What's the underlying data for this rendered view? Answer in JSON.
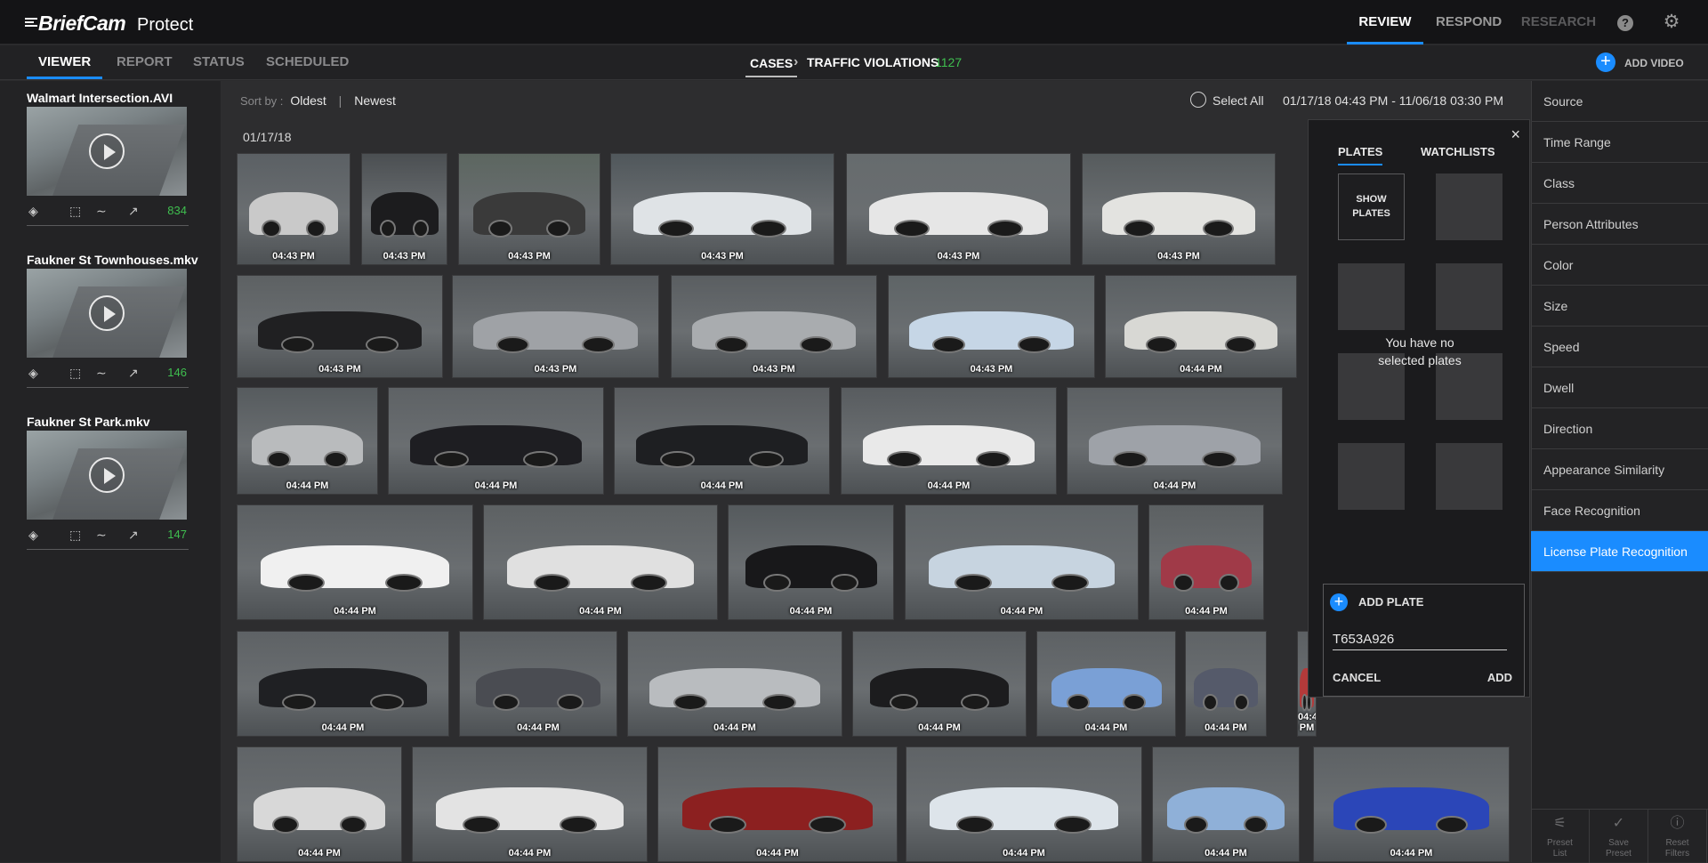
{
  "app": {
    "brand": "BriefCam",
    "product": "Protect"
  },
  "topnav": {
    "review": "REVIEW",
    "respond": "RESPOND",
    "research": "RESEARCH",
    "help": "?",
    "settings": "⚙"
  },
  "subnav": {
    "viewer": "VIEWER",
    "report": "REPORT",
    "status": "STATUS",
    "scheduled": "SCHEDULED"
  },
  "breadcrumb": {
    "cases": "CASES",
    "sep": "›",
    "current": "TRAFFIC VIOLATIONS",
    "count": "1127"
  },
  "add_video": {
    "label": "ADD VIDEO",
    "icon": "+"
  },
  "videos": [
    {
      "title": "Walmart Intersection.AVI",
      "count": "834"
    },
    {
      "title": "Faukner St Townhouses.mkv",
      "count": "146"
    },
    {
      "title": "Faukner St Park.mkv",
      "count": "147"
    }
  ],
  "sort": {
    "label": "Sort by :",
    "oldest": "Oldest",
    "sep": "|",
    "newest": "Newest"
  },
  "select_all": "Select All",
  "date_range": "01/17/18 04:43 PM - 11/06/18 03:30 PM",
  "date_group": "01/17/18",
  "tiles": [
    {
      "time": "04:43 PM",
      "color": "#c9c9c9",
      "bg": "#5b6064"
    },
    {
      "time": "04:43 PM",
      "color": "#1c1c1e",
      "bg": "#4b4f52"
    },
    {
      "time": "04:43 PM",
      "color": "#3a3a3a",
      "bg": "#5c6660"
    },
    {
      "time": "04:43 PM",
      "color": "#dfe3e6",
      "bg": "#50575b"
    },
    {
      "time": "04:43 PM",
      "color": "#e6e6e6",
      "bg": "#666b6d"
    },
    {
      "time": "04:43 PM",
      "color": "#e3e3e0",
      "bg": "#565b5d"
    },
    {
      "time": "04:43 PM",
      "color": "#202022",
      "bg": "#5d6163"
    },
    {
      "time": "04:43 PM",
      "color": "#9fa2a6",
      "bg": "#585c5f"
    },
    {
      "time": "04:43 PM",
      "color": "#a9acaf",
      "bg": "#5a5e61"
    },
    {
      "time": "04:43 PM",
      "color": "#c6d6e6",
      "bg": "#5e6466"
    },
    {
      "time": "04:44 PM",
      "color": "#d8d8d4",
      "bg": "#5b6063"
    },
    {
      "time": "04:44 PM",
      "color": "#b9bbbd",
      "bg": "#565b5e"
    },
    {
      "time": "04:44 PM",
      "color": "#1e1e22",
      "bg": "#5e6265"
    },
    {
      "time": "04:44 PM",
      "color": "#1e1f22",
      "bg": "#5a5d60"
    },
    {
      "time": "04:44 PM",
      "color": "#e9e9e9",
      "bg": "#585c5f"
    },
    {
      "time": "04:44 PM",
      "color": "#9ea2a8",
      "bg": "#5c6063"
    },
    {
      "time": "04:44 PM",
      "color": "#f0f0f0",
      "bg": "#5b5f62"
    },
    {
      "time": "04:44 PM",
      "color": "#e0e0e0",
      "bg": "#5d6163"
    },
    {
      "time": "04:44 PM",
      "color": "#18181a",
      "bg": "#555a5d"
    },
    {
      "time": "04:44 PM",
      "color": "#c7d4e0",
      "bg": "#5f6467"
    },
    {
      "time": "04:44 PM",
      "color": "#a03a48",
      "bg": "#5c6062"
    },
    {
      "time": "04:44 PM",
      "color": "#1f2023",
      "bg": "#5e6265"
    },
    {
      "time": "04:44 PM",
      "color": "#4a4c52",
      "bg": "#5b5f62"
    },
    {
      "time": "04:44 PM",
      "color": "#b9bcbf",
      "bg": "#606467"
    },
    {
      "time": "04:44 PM",
      "color": "#1c1c1e",
      "bg": "#5b5f62"
    },
    {
      "time": "04:44 PM",
      "color": "#7aa0d6",
      "bg": "#5d6164"
    },
    {
      "time": "04:44 PM",
      "color": "#555a6a",
      "bg": "#5f6366"
    },
    {
      "time": "04:44 PM",
      "color": "#b33a3a",
      "bg": "#5c6063"
    },
    {
      "time": "04:44 PM",
      "color": "#d8d8d8",
      "bg": "#606467"
    },
    {
      "time": "04:44 PM",
      "color": "#e3e3e3",
      "bg": "#5b5f62"
    },
    {
      "time": "04:44 PM",
      "color": "#8c2020",
      "bg": "#5c6063"
    },
    {
      "time": "04:44 PM",
      "color": "#dde4ea",
      "bg": "#5f6366"
    },
    {
      "time": "04:44 PM",
      "color": "#8fb0d8",
      "bg": "#5b5f62"
    },
    {
      "time": "04:44 PM",
      "color": "#2b46b8",
      "bg": "#5d6164"
    }
  ],
  "plates_panel": {
    "close": "×",
    "tab_plates": "PLATES",
    "tab_watchlists": "WATCHLISTS",
    "show_plates": "SHOW PLATES",
    "empty_line1": "You have no",
    "empty_line2": "selected plates"
  },
  "add_plate": {
    "label": "ADD PLATE",
    "icon": "+",
    "value": "T653A926",
    "cancel": "CANCEL",
    "add": "ADD"
  },
  "filters": [
    "Source",
    "Time Range",
    "Class",
    "Person Attributes",
    "Color",
    "Size",
    "Speed",
    "Dwell",
    "Direction",
    "Appearance Similarity",
    "Face Recognition",
    "License Plate Recognition"
  ],
  "active_filter": "License Plate Recognition",
  "bottom_tools": [
    {
      "icon": "⚟",
      "line1": "Preset",
      "line2": "List"
    },
    {
      "icon": "✓",
      "line1": "Save",
      "line2": "Preset"
    },
    {
      "icon": "ⓘ",
      "line1": "Reset",
      "line2": "Filters"
    }
  ],
  "colors": {
    "accent": "#1a8cff",
    "count_green": "#3fbf4f"
  }
}
